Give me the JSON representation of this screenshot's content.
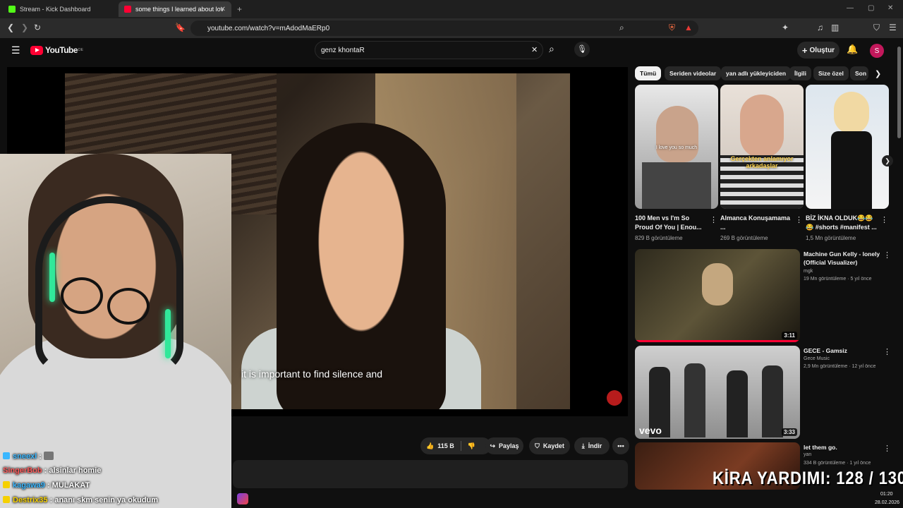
{
  "browser": {
    "tabs": [
      {
        "label": "Stream - Kick Dashboard",
        "icon": "kick-logo-icon"
      },
      {
        "label": "some things I learned about lov",
        "icon": "youtube-icon"
      }
    ],
    "url": "youtube.com/watch?v=mAdodMaERp0"
  },
  "youtube": {
    "logo": "YouTube",
    "region": "DE",
    "search_value": "genz khontaR",
    "create_label": "Oluştur",
    "avatar_initial": "S"
  },
  "video": {
    "subtitle": "it is important to find silence and",
    "actions": {
      "likes": "115 B",
      "share": "Paylaş",
      "save": "Kaydet",
      "download": "İndir"
    }
  },
  "chat": [
    {
      "user": "sneexl",
      "message": "",
      "user_color": "#3ab7ff"
    },
    {
      "user": "SingerBob",
      "message": "alsinlar homie",
      "user_color": "#ff5a5a"
    },
    {
      "user": "kagawa9",
      "message": "MULAKAT",
      "user_color": "#3ab7ff"
    },
    {
      "user": "Destrix35",
      "message": "ananı skm senin ya okudum",
      "user_color": "#f5d000"
    }
  ],
  "chips": [
    "Tümü",
    "Seriden videolar",
    "yan adlı yükleyiciden",
    "İlgili",
    "Size özel",
    "Son"
  ],
  "shorts": [
    {
      "title": "100 Men vs I'm So Proud Of You | Enou...",
      "views": "829 B görüntüleme",
      "caption": "I love you so much"
    },
    {
      "title": "Almanca Konuşamama ...",
      "views": "269 B görüntüleme",
      "caption": "Gerçekten anlamıyor arkadaşlar"
    },
    {
      "title": "BİZ İKNA OLDUK😂😂😂 #shorts #manifest ...",
      "views": "1,5 Mn görüntüleme",
      "caption": ""
    }
  ],
  "videos": [
    {
      "title": "Machine Gun Kelly - lonely (Official Visualizer)",
      "channel": "mgk",
      "meta": "19 Mn görüntüleme · 5 yıl önce",
      "duration": "3:11"
    },
    {
      "title": "GECE - Gamsiz",
      "channel": "Gece Music",
      "meta": "2,9 Mn görüntüleme · 12 yıl önce",
      "duration": "3:33",
      "watermark": "vevo"
    },
    {
      "title": "let them go.",
      "channel": "yan",
      "meta": "334 B görüntüleme · 1 yıl önce",
      "duration": ""
    }
  ],
  "overlay": {
    "kira": "KİRA YARDIMI:  128 / 130",
    "time": "01:20",
    "date": "28.02.2026"
  },
  "colors": {
    "youtube_red": "#ff0033",
    "background": "#0f0f0f",
    "webcam_glow": "#31e89a"
  }
}
